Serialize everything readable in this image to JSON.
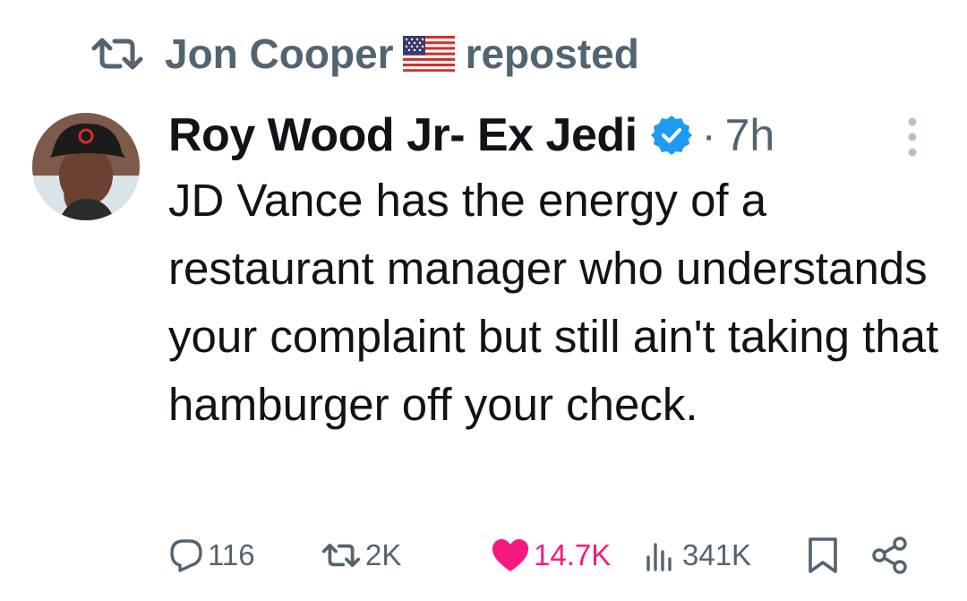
{
  "repost_banner": {
    "reposter_name": "Jon Cooper",
    "flag_icon": "us-flag-icon",
    "action_text": "reposted"
  },
  "tweet": {
    "author_name": "Roy Wood Jr- Ex Jedi",
    "separator": "·",
    "time": "7h",
    "verified": true,
    "text": "JD Vance has the energy of a restaurant manager who understands your complaint but still ain't taking that hamburger off your check."
  },
  "actions": {
    "replies": "116",
    "reposts": "2K",
    "likes": "14.7K",
    "views": "341K"
  },
  "colors": {
    "text": "#0f1419",
    "muted": "#536471",
    "verified": "#1d9bf0",
    "like": "#f91880"
  }
}
